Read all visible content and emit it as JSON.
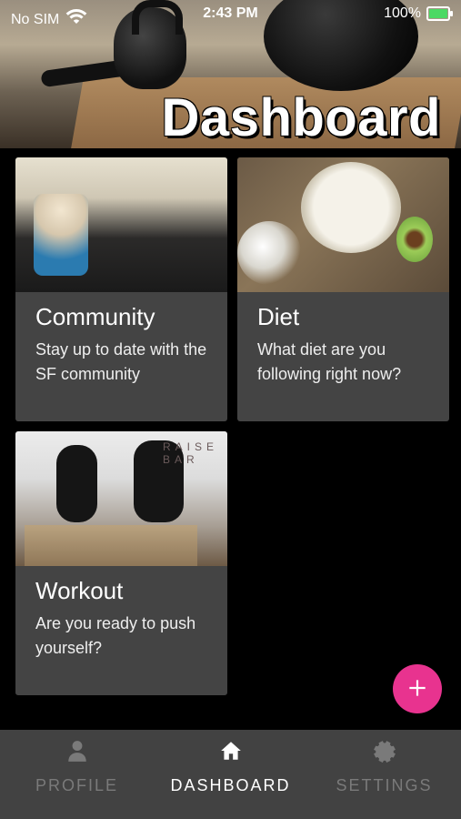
{
  "statusBar": {
    "carrier": "No SIM",
    "time": "2:43 PM",
    "battery": "100%"
  },
  "header": {
    "title": "Dashboard"
  },
  "cards": [
    {
      "title": "Community",
      "text": "Stay up to date with the SF community"
    },
    {
      "title": "Diet",
      "text": "What diet are you following right now?"
    },
    {
      "title": "Workout",
      "text": "Are you ready to push yourself?"
    }
  ],
  "fab": {
    "icon": "plus-icon",
    "color": "#e8338f"
  },
  "bottomNav": {
    "items": [
      {
        "label": "PROFILE",
        "icon": "person-icon",
        "active": false
      },
      {
        "label": "DASHBOARD",
        "icon": "home-icon",
        "active": true
      },
      {
        "label": "SETTINGS",
        "icon": "gear-icon",
        "active": false
      }
    ]
  },
  "colors": {
    "background": "#000000",
    "card": "#444444",
    "nav": "#424242",
    "accent": "#e8338f"
  }
}
